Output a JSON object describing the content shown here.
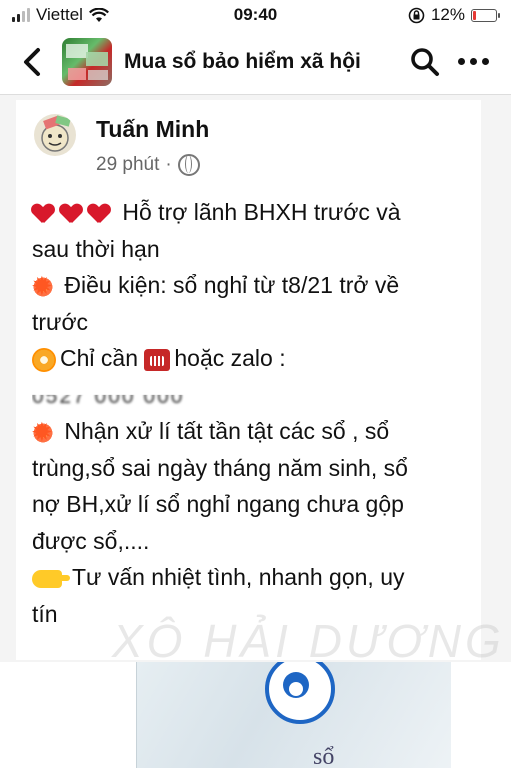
{
  "status_bar": {
    "carrier": "Viettel",
    "time": "09:40",
    "battery_percent": "12%",
    "battery_level": 0.12,
    "battery_color": "#e53935",
    "icons": [
      "signal-icon",
      "wifi-icon",
      "orientation-lock-icon",
      "battery-icon"
    ]
  },
  "nav": {
    "title": "Mua sổ bảo hiểm xã hội",
    "icons": [
      "back-icon",
      "group-thumbnail",
      "search-icon",
      "more-icon"
    ]
  },
  "post": {
    "author": "Tuấn Minh",
    "time": "29 phút",
    "separator": "·",
    "privacy_icon": "globe-icon",
    "lines": [
      {
        "emoji": "heart-icon",
        "text": "Hỗ trợ lãnh BHXH trước và"
      },
      {
        "emoji": "",
        "text": "sau thời hạn"
      },
      {
        "emoji": "collision-icon",
        "text": "Điều kiện: sổ nghỉ từ t8/21 trở về"
      },
      {
        "emoji": "",
        "text": "trước"
      },
      {
        "emoji": "flower-icon",
        "text": "Chỉ cần"
      },
      {
        "emoji": "",
        "text": "0527 000 000"
      },
      {
        "emoji": "collision-icon",
        "text": "Nhận xử lí tất tần tật các sổ , sổ"
      },
      {
        "emoji": "",
        "text": "trùng,sổ sai ngày tháng năm sinh, sổ"
      },
      {
        "emoji": "",
        "text": "nợ BH,xử lí sổ nghỉ ngang chưa gộp"
      },
      {
        "emoji": "",
        "text": "được sổ,...."
      },
      {
        "emoji": "pointing-hand-icon",
        "text": "Tư vấn nhiệt tình, nhanh gọn, uy"
      },
      {
        "emoji": "",
        "text": "tín"
      }
    ],
    "phone_suffix": "hoặc zalo :"
  },
  "image": {
    "booklet_word": "sổ"
  },
  "watermark": "XÔ HẢI DƯƠNG"
}
